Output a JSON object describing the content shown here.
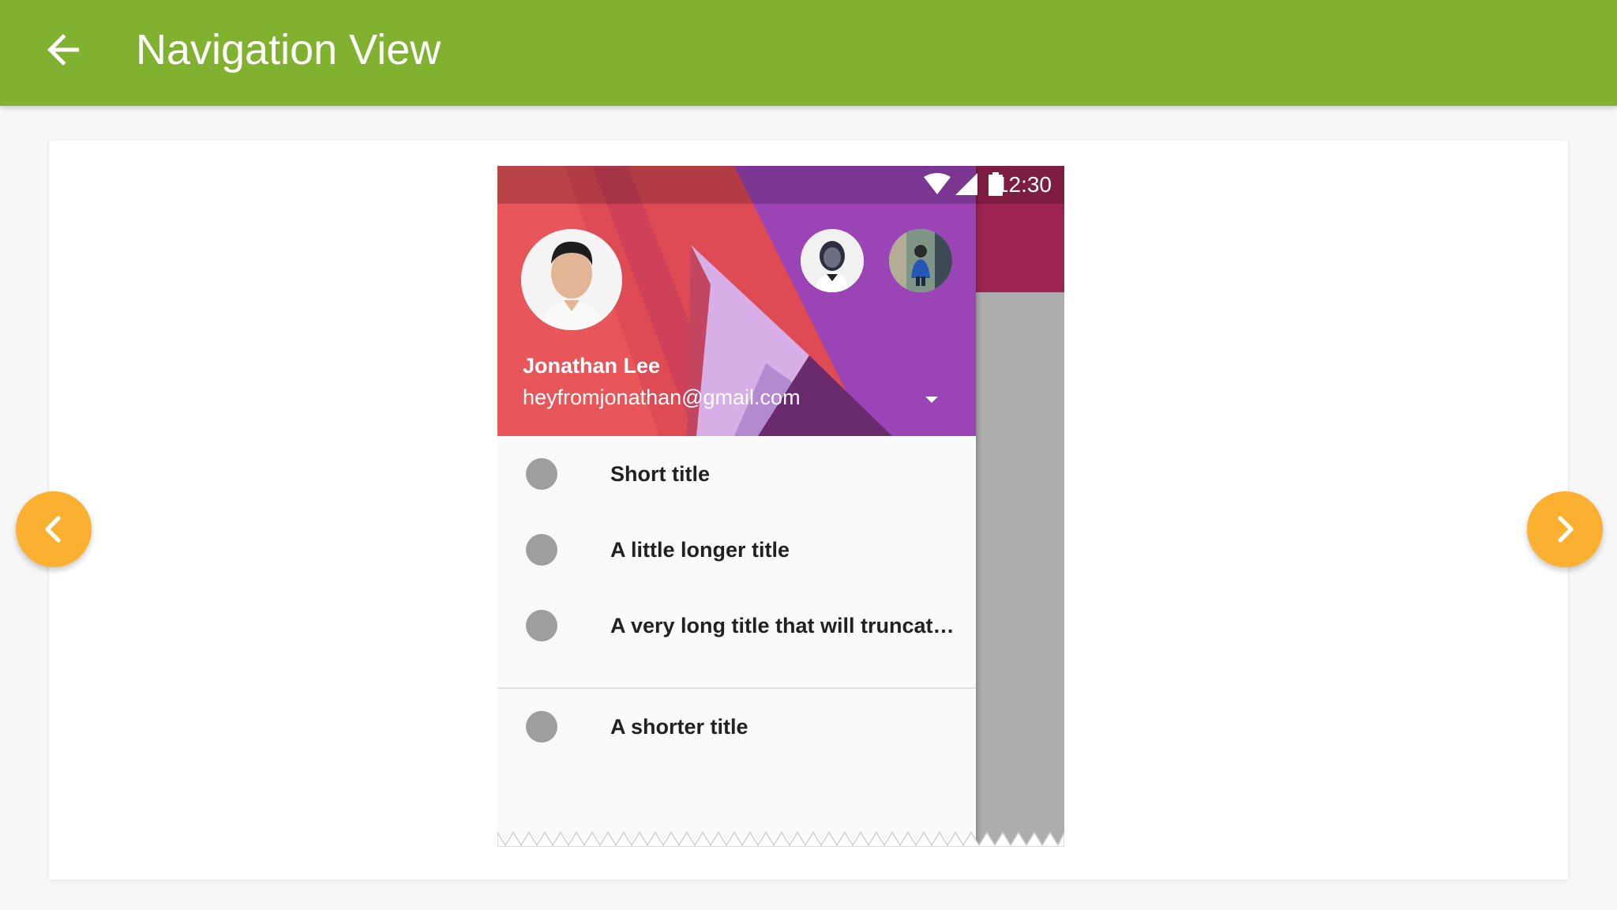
{
  "appbar": {
    "title": "Navigation View",
    "back_icon": "arrow-back-icon",
    "color": "#80b22f"
  },
  "phone": {
    "status_bar": {
      "time": "12:30",
      "icons": [
        "wifi-icon",
        "cell-signal-icon",
        "battery-icon"
      ]
    },
    "drawer": {
      "account": {
        "name": "Jonathan Lee",
        "email": "heyfromjonathan@gmail.com"
      },
      "items": [
        {
          "label": "Short title"
        },
        {
          "label": "A little longer title"
        },
        {
          "label": "A very long title that will truncat…"
        },
        {
          "label": "A shorter title"
        }
      ]
    }
  },
  "carousel": {
    "prev_icon": "chevron-left-icon",
    "next_icon": "chevron-right-icon",
    "accent": "#fbb12f"
  }
}
